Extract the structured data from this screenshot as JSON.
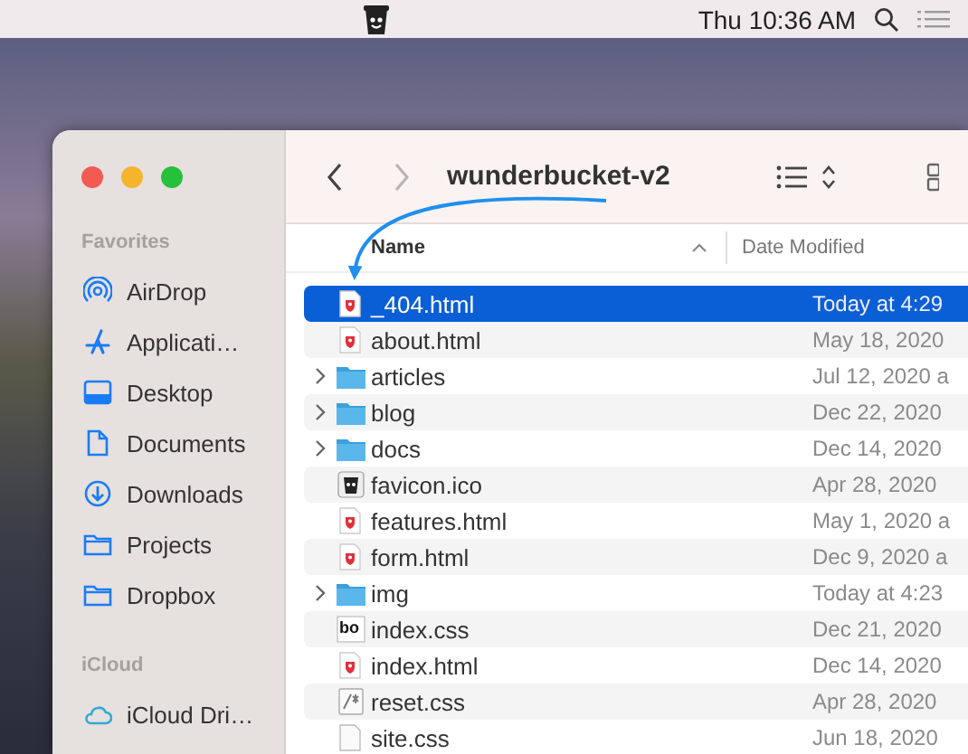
{
  "menu_bar": {
    "clock": "Thu 10:36 AM"
  },
  "window": {
    "title": "wunderbucket-v2",
    "forward_disabled": true
  },
  "sidebar": {
    "sections": [
      {
        "heading": "Favorites",
        "items": [
          {
            "label": "AirDrop",
            "kind": "airdrop"
          },
          {
            "label": "Applicati…",
            "kind": "apps"
          },
          {
            "label": "Desktop",
            "kind": "desktop"
          },
          {
            "label": "Documents",
            "kind": "document"
          },
          {
            "label": "Downloads",
            "kind": "download"
          },
          {
            "label": "Projects",
            "kind": "folder"
          },
          {
            "label": "Dropbox",
            "kind": "folder"
          }
        ]
      },
      {
        "heading": "iCloud",
        "items": [
          {
            "label": "iCloud Dri…",
            "kind": "cloud"
          }
        ]
      }
    ]
  },
  "table": {
    "columns": [
      "Name",
      "Date Modified"
    ],
    "rows": [
      {
        "name": "_404.html",
        "date": "Today at 4:29",
        "kind": "html",
        "expandable": false,
        "selected": true
      },
      {
        "name": "about.html",
        "date": "May 18, 2020",
        "kind": "html",
        "expandable": false,
        "selected": false
      },
      {
        "name": "articles",
        "date": "Jul 12, 2020 a",
        "kind": "folder",
        "expandable": true,
        "selected": false
      },
      {
        "name": "blog",
        "date": "Dec 22, 2020",
        "kind": "folder",
        "expandable": true,
        "selected": false
      },
      {
        "name": "docs",
        "date": "Dec 14, 2020",
        "kind": "folder",
        "expandable": true,
        "selected": false
      },
      {
        "name": "favicon.ico",
        "date": "Apr 28, 2020",
        "kind": "bucket",
        "expandable": false,
        "selected": false
      },
      {
        "name": "features.html",
        "date": "May 1, 2020 a",
        "kind": "html",
        "expandable": false,
        "selected": false
      },
      {
        "name": "form.html",
        "date": "Dec 9, 2020 a",
        "kind": "html",
        "expandable": false,
        "selected": false
      },
      {
        "name": "img",
        "date": "Today at 4:23",
        "kind": "folder",
        "expandable": true,
        "selected": false
      },
      {
        "name": "index.css",
        "date": "Dec 21, 2020",
        "kind": "bo",
        "expandable": false,
        "selected": false
      },
      {
        "name": "index.html",
        "date": "Dec 14, 2020",
        "kind": "html",
        "expandable": false,
        "selected": false
      },
      {
        "name": "reset.css",
        "date": "Apr 28, 2020",
        "kind": "script",
        "expandable": false,
        "selected": false
      },
      {
        "name": "site.css",
        "date": "Jun 18, 2020",
        "kind": "blank",
        "expandable": false,
        "selected": false
      }
    ]
  }
}
